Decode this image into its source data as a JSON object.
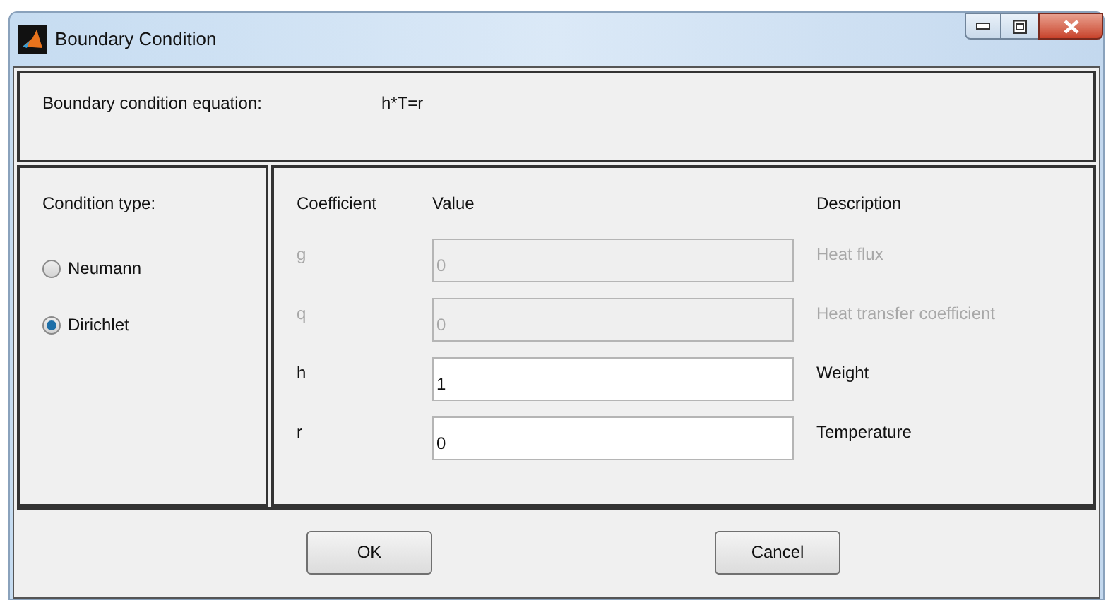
{
  "window": {
    "title": "Boundary Condition"
  },
  "equation": {
    "label": "Boundary condition equation:",
    "value": "h*T=r"
  },
  "condition_type": {
    "label": "Condition type:",
    "options": [
      {
        "label": "Neumann",
        "selected": false
      },
      {
        "label": "Dirichlet",
        "selected": true
      }
    ]
  },
  "coefficients": {
    "columns": [
      "Coefficient",
      "Value",
      "Description"
    ],
    "rows": [
      {
        "name": "g",
        "value": "0",
        "description": "Heat flux",
        "disabled": true
      },
      {
        "name": "q",
        "value": "0",
        "description": "Heat transfer coefficient",
        "disabled": true
      },
      {
        "name": "h",
        "value": "1",
        "description": "Weight",
        "disabled": false
      },
      {
        "name": "r",
        "value": "0",
        "description": "Temperature",
        "disabled": false
      }
    ]
  },
  "buttons": [
    "OK",
    "Cancel"
  ]
}
